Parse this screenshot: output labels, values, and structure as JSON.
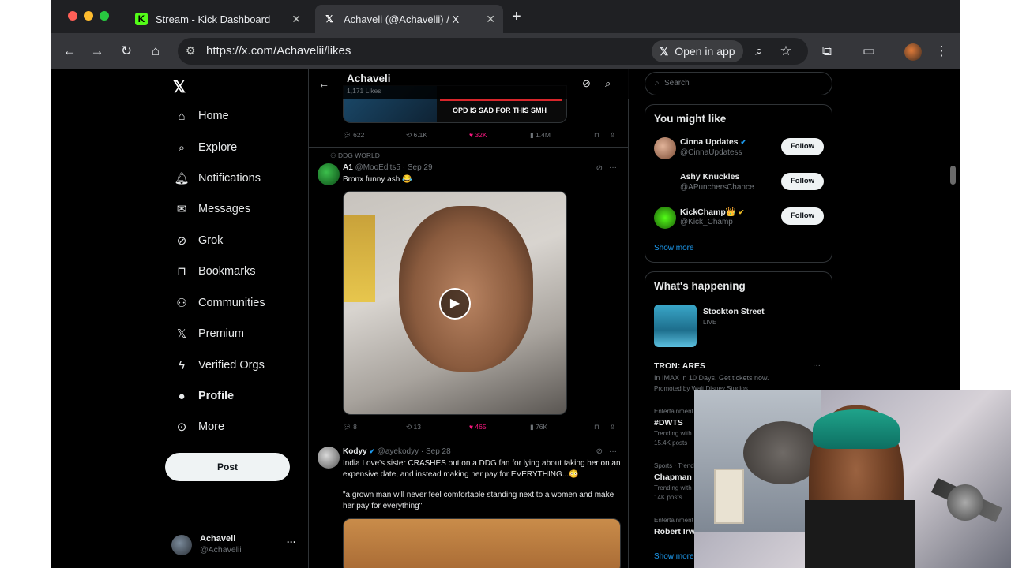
{
  "browser": {
    "tabs": [
      {
        "title": "Stream - Kick Dashboard",
        "icon": "kick-icon",
        "active": false
      },
      {
        "title": "Achaveli (@Achavelii) / X",
        "icon": "x-logo-icon",
        "active": true
      }
    ],
    "url": "https://x.com/Achavelii/likes",
    "open_in_app": "Open in app"
  },
  "nav": {
    "items": [
      {
        "label": "Home",
        "icon": "home-icon"
      },
      {
        "label": "Explore",
        "icon": "search-icon"
      },
      {
        "label": "Notifications",
        "icon": "bell-icon"
      },
      {
        "label": "Messages",
        "icon": "mail-icon"
      },
      {
        "label": "Grok",
        "icon": "grok-icon"
      },
      {
        "label": "Bookmarks",
        "icon": "bookmark-icon"
      },
      {
        "label": "Communities",
        "icon": "people-icon"
      },
      {
        "label": "Premium",
        "icon": "x-logo-icon"
      },
      {
        "label": "Verified Orgs",
        "icon": "lightning-icon"
      },
      {
        "label": "Profile",
        "icon": "person-icon"
      },
      {
        "label": "More",
        "icon": "more-circle-icon"
      }
    ],
    "post_label": "Post",
    "account": {
      "name": "Achaveli",
      "handle": "@Achavelii",
      "more": "···"
    }
  },
  "timeline": {
    "header": {
      "title": "Achaveli",
      "subtitle": "1,171 Likes"
    },
    "prev_tweet": {
      "media_caption": "OPD IS SAD FOR THIS SMH",
      "replies": "622",
      "reposts": "6.1K",
      "likes": "32K",
      "views": "1.4M"
    },
    "tweet1": {
      "social_context": "DDG WORLD",
      "name": "A1",
      "handle": "@MooEdits5 · Sep 29",
      "text": "Bronx funny ash 😂",
      "replies": "8",
      "reposts": "13",
      "likes": "465",
      "views": "76K"
    },
    "tweet2": {
      "name": "Kodyy",
      "handle": "@ayekodyy · Sep 28",
      "text1": "India Love's sister CRASHES out on a DDG fan for lying about taking her on an expensive date, and instead making her pay for EVERYTHING...😳",
      "text2": "\"a grown man will never feel comfortable standing next to a women and make her pay for everything\""
    }
  },
  "sidebar": {
    "search_placeholder": "Search",
    "who_to_follow": {
      "title": "You might like",
      "users": [
        {
          "name": "Cinna Updates",
          "handle": "@CinnaUpdatess",
          "verified": true,
          "button": "Follow"
        },
        {
          "name": "Ashy Knuckles",
          "handle": "@APunchersChance",
          "verified": false,
          "button": "Follow"
        },
        {
          "name": "KickChamp👑",
          "handle": "@Kick_Champ",
          "verified": true,
          "button": "Follow"
        }
      ],
      "show_more": "Show more"
    },
    "happening": {
      "title": "What's happening",
      "live": {
        "title": "Stockton Street",
        "status": "LIVE"
      },
      "promo": {
        "title": "TRON: ARES",
        "line": "In IMAX in 10 Days. Get tickets now.",
        "promoted": "Promoted by Walt Disney Studios"
      },
      "trends": [
        {
          "category": "Entertainment",
          "name": "#DWTS",
          "meta1": "Trending with",
          "meta2": "15.4K posts"
        },
        {
          "category": "Sports · Trending",
          "name": "Chapman",
          "meta1": "Trending with",
          "meta2": "14K posts"
        },
        {
          "category": "Entertainment",
          "name": "Robert Irwi",
          "meta1": "",
          "meta2": ""
        }
      ],
      "show_more": "Show more"
    }
  },
  "colors": {
    "like": "#f91880",
    "link": "#1d9bf0",
    "kick": "#53fc18"
  }
}
